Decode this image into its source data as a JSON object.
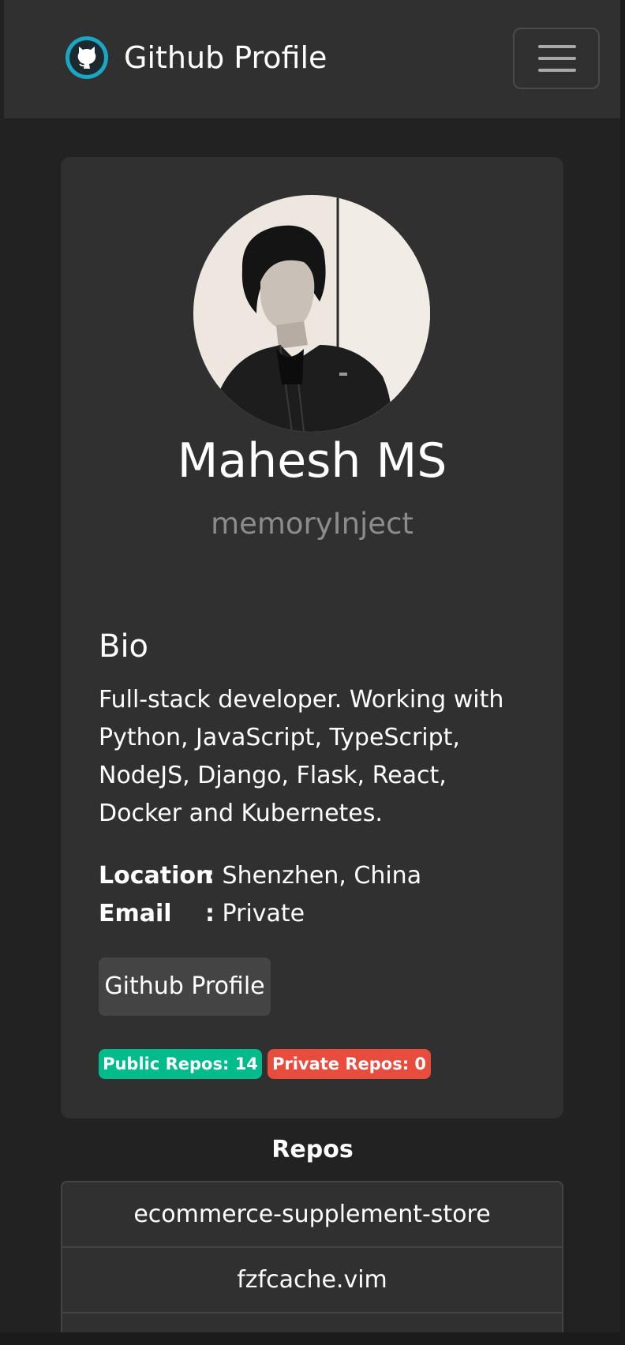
{
  "navbar": {
    "brand_title": "Github Profile",
    "logo_icon": "github-octocat-icon",
    "menu_icon": "hamburger-menu-icon"
  },
  "profile": {
    "name": "Mahesh MS",
    "username": "memoryInject",
    "avatar": "profile-photo",
    "bio_heading": "Bio",
    "bio_text": "Full-stack developer. Working with Python, JavaScript, TypeScript, NodeJS, Django, Flask, React, Docker and Kubernetes.",
    "location_label": "Location",
    "location_value": "Shenzhen, China",
    "email_label": "Email",
    "email_value": "Private",
    "separator": ":",
    "profile_button_label": "Github Profile",
    "public_repos_badge": "Public Repos: 14",
    "private_repos_badge": "Private Repos: 0"
  },
  "repos": {
    "heading": "Repos",
    "items": [
      "ecommerce-supplement-store",
      "fzfcache.vim",
      ""
    ]
  },
  "colors": {
    "page_background": "#222222",
    "navbar_background": "#303030",
    "card_background": "#303030",
    "muted_text": "#8c8c8c",
    "public_badge": "#00bc8c",
    "private_badge": "#e74c3c",
    "button_background": "#444444"
  }
}
